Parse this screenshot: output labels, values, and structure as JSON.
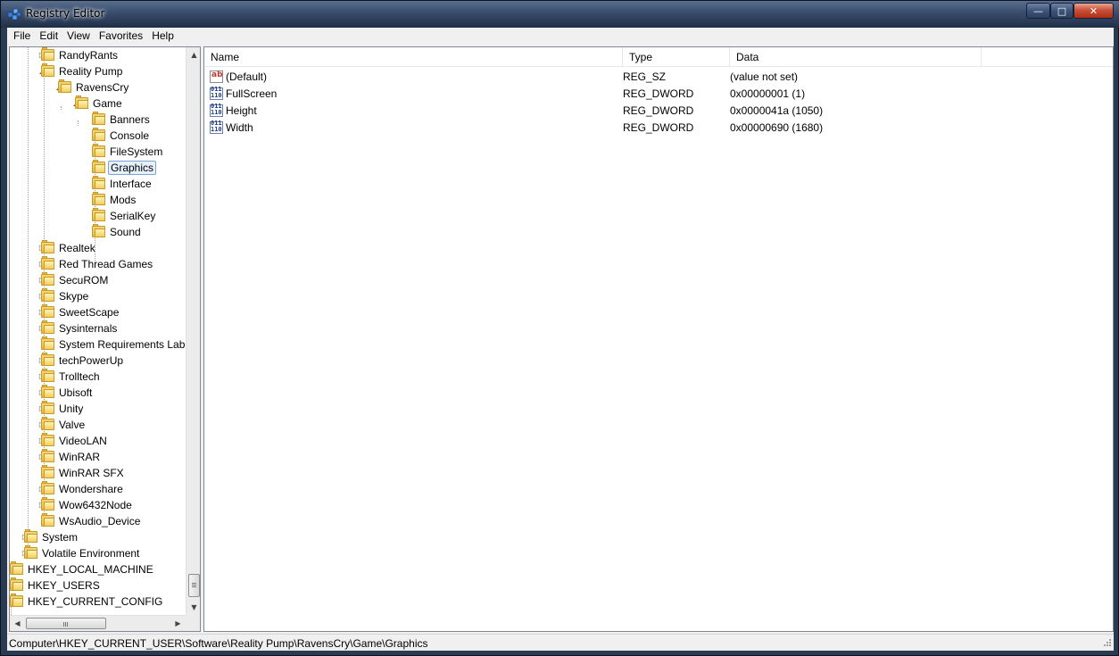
{
  "window": {
    "title": "Registry Editor",
    "controls": {
      "minimize": "—",
      "maximize": "□",
      "close": "✕"
    }
  },
  "menu": [
    "File",
    "Edit",
    "View",
    "Favorites",
    "Help"
  ],
  "tree": [
    {
      "label": "RandyRants",
      "depth": 2,
      "expander": "collapsed"
    },
    {
      "label": "Reality Pump",
      "depth": 2,
      "expander": "expanded"
    },
    {
      "label": "RavensCry",
      "depth": 3,
      "expander": "expanded"
    },
    {
      "label": "Game",
      "depth": 4,
      "expander": "expanded"
    },
    {
      "label": "Banners",
      "depth": 5,
      "expander": "none"
    },
    {
      "label": "Console",
      "depth": 5,
      "expander": "none"
    },
    {
      "label": "FileSystem",
      "depth": 5,
      "expander": "none"
    },
    {
      "label": "Graphics",
      "depth": 5,
      "expander": "none",
      "selected": true
    },
    {
      "label": "Interface",
      "depth": 5,
      "expander": "none"
    },
    {
      "label": "Mods",
      "depth": 5,
      "expander": "none"
    },
    {
      "label": "SerialKey",
      "depth": 5,
      "expander": "none"
    },
    {
      "label": "Sound",
      "depth": 5,
      "expander": "none"
    },
    {
      "label": "Realtek",
      "depth": 2,
      "expander": "collapsed"
    },
    {
      "label": "Red Thread Games",
      "depth": 2,
      "expander": "collapsed"
    },
    {
      "label": "SecuROM",
      "depth": 2,
      "expander": "collapsed"
    },
    {
      "label": "Skype",
      "depth": 2,
      "expander": "collapsed"
    },
    {
      "label": "SweetScape",
      "depth": 2,
      "expander": "collapsed"
    },
    {
      "label": "Sysinternals",
      "depth": 2,
      "expander": "collapsed"
    },
    {
      "label": "System Requirements Lab",
      "depth": 2,
      "expander": "none"
    },
    {
      "label": "techPowerUp",
      "depth": 2,
      "expander": "collapsed"
    },
    {
      "label": "Trolltech",
      "depth": 2,
      "expander": "collapsed"
    },
    {
      "label": "Ubisoft",
      "depth": 2,
      "expander": "collapsed"
    },
    {
      "label": "Unity",
      "depth": 2,
      "expander": "collapsed"
    },
    {
      "label": "Valve",
      "depth": 2,
      "expander": "collapsed"
    },
    {
      "label": "VideoLAN",
      "depth": 2,
      "expander": "collapsed"
    },
    {
      "label": "WinRAR",
      "depth": 2,
      "expander": "collapsed"
    },
    {
      "label": "WinRAR SFX",
      "depth": 2,
      "expander": "none"
    },
    {
      "label": "Wondershare",
      "depth": 2,
      "expander": "collapsed"
    },
    {
      "label": "Wow6432Node",
      "depth": 2,
      "expander": "collapsed"
    },
    {
      "label": "WsAudio_Device",
      "depth": 2,
      "expander": "none"
    },
    {
      "label": "System",
      "depth": 1,
      "expander": "collapsed"
    },
    {
      "label": "Volatile Environment",
      "depth": 1,
      "expander": "collapsed"
    },
    {
      "label": "HKEY_LOCAL_MACHINE",
      "depth": 0,
      "expander": "collapsed"
    },
    {
      "label": "HKEY_USERS",
      "depth": 0,
      "expander": "collapsed"
    },
    {
      "label": "HKEY_CURRENT_CONFIG",
      "depth": 0,
      "expander": "collapsed"
    }
  ],
  "list": {
    "columns": [
      "Name",
      "Type",
      "Data"
    ],
    "rows": [
      {
        "name": "(Default)",
        "type": "REG_SZ",
        "data": "(value not set)",
        "icon": "string-value-icon"
      },
      {
        "name": "FullScreen",
        "type": "REG_DWORD",
        "data": "0x00000001 (1)",
        "icon": "binary-value-icon"
      },
      {
        "name": "Height",
        "type": "REG_DWORD",
        "data": "0x0000041a (1050)",
        "icon": "binary-value-icon"
      },
      {
        "name": "Width",
        "type": "REG_DWORD",
        "data": "0x00000690 (1680)",
        "icon": "binary-value-icon"
      }
    ]
  },
  "status": {
    "path": "Computer\\HKEY_CURRENT_USER\\Software\\Reality Pump\\RavensCry\\Game\\Graphics"
  }
}
